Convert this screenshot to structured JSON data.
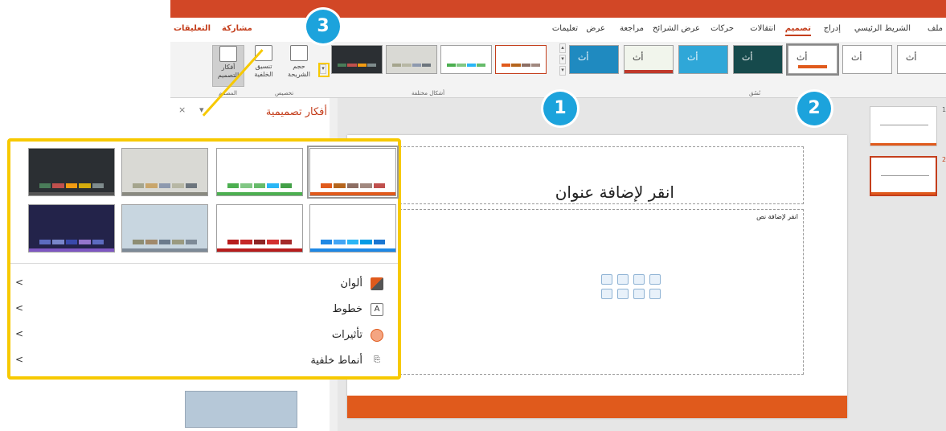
{
  "tabs": {
    "file": "ملف",
    "home": "الشريط الرئيسي",
    "insert": "إدراج",
    "design": "تصميم",
    "transitions": "انتقالات",
    "animations": "حركات",
    "slideshow": "عرض الشرائح",
    "review": "مراجعة",
    "view": "عرض",
    "help": "تعليمات",
    "share": "مشاركة",
    "comments": "التعليقات"
  },
  "ribbon": {
    "design_ideas_label": "أفكار التصميم",
    "slide_size_label": "حجم الشريحة",
    "format_bg_label": "تنسيق الخلفية",
    "group_designer": "المصمم",
    "group_customize": "تخصيص",
    "group_variants": "أشكال مختلفة",
    "group_themes": "نُسُق",
    "theme_letter": "أث"
  },
  "pane": {
    "title": "أفكار تصميمية",
    "close": "×",
    "dropdown": "▾"
  },
  "slide": {
    "title_placeholder": "انقر لإضافة عنوان",
    "body_placeholder": "انقر لإضافة نص"
  },
  "popup": {
    "menu": [
      {
        "label": "ألوان",
        "icon": "colors-icon"
      },
      {
        "label": "خطوط",
        "icon": "fonts-icon"
      },
      {
        "label": "تأثيرات",
        "icon": "effects-icon"
      },
      {
        "label": "أنماط خلفية",
        "icon": "background-styles-icon"
      }
    ]
  },
  "markers": {
    "m1": "1",
    "m2": "2",
    "m3": "3"
  },
  "slide_numbers": {
    "s1": "1",
    "s2": "2"
  },
  "colors": {
    "accent": "#c43e1c",
    "highlight": "#f7c900",
    "marker": "#1ca3dc",
    "orange_bar": "#e05a1c"
  }
}
